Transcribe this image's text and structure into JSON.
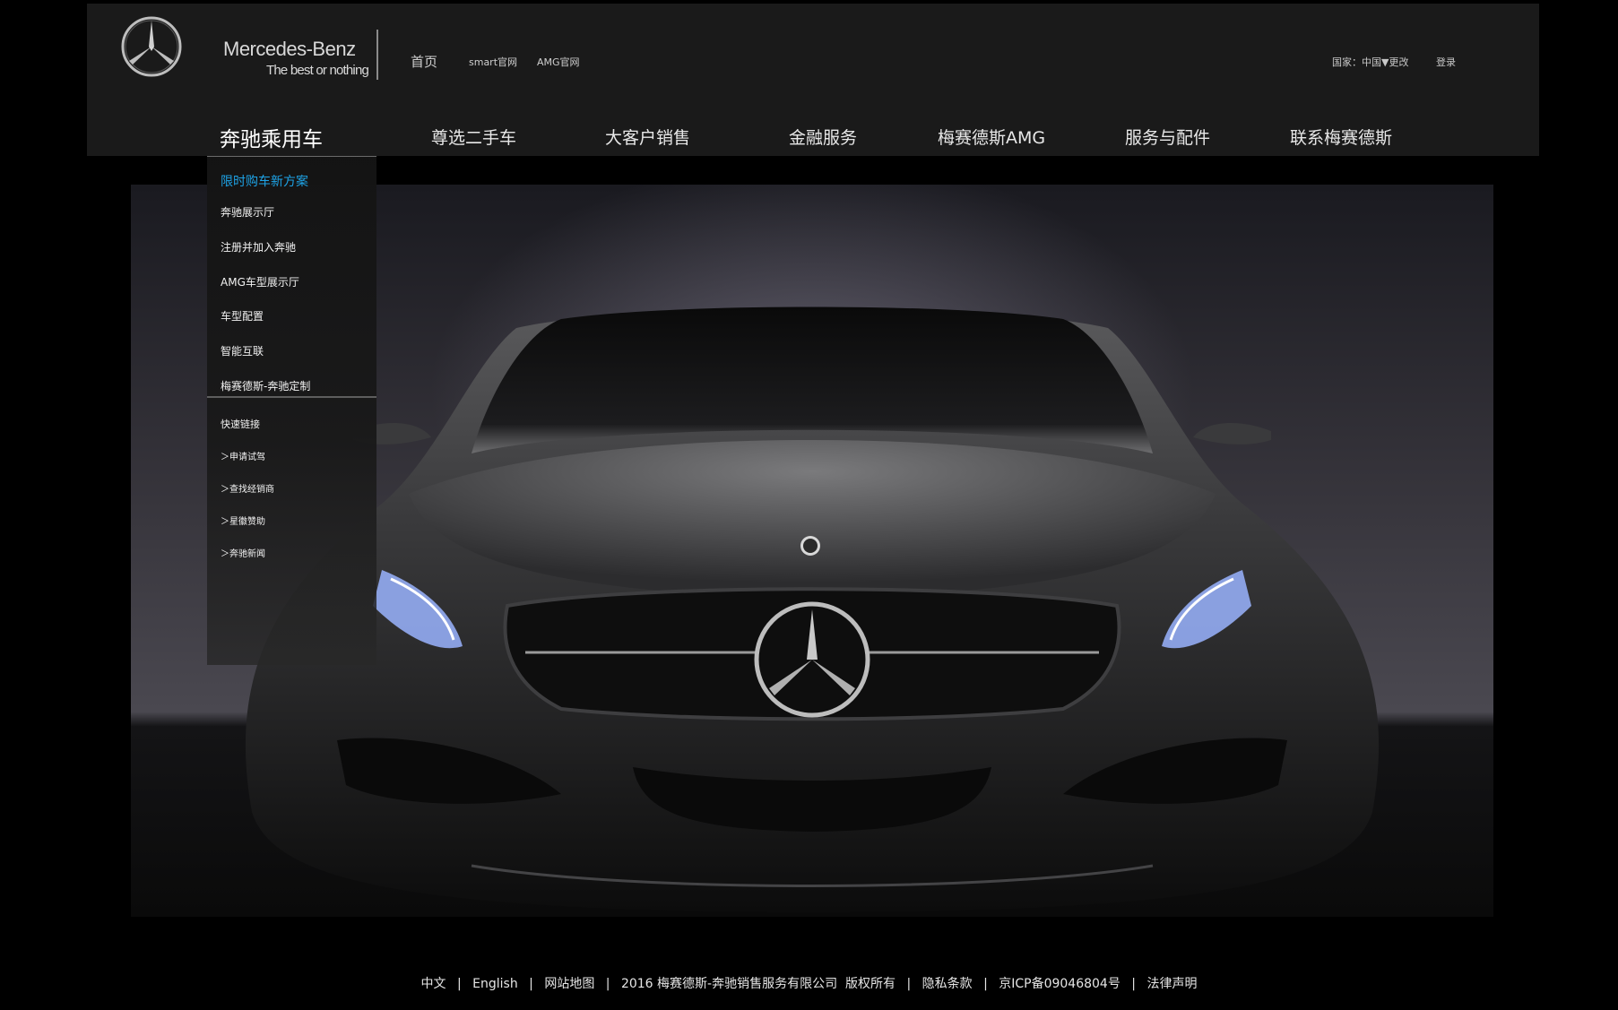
{
  "brand": {
    "name": "Mercedes-Benz",
    "tagline": "The best or nothing",
    "star_color": "#c8c8c8"
  },
  "top_links": {
    "home": "首页",
    "smart": "smart官网",
    "amg": "AMG官网",
    "country": "国家：中国",
    "change": "▼更改",
    "login": "登录"
  },
  "main_nav": [
    "奔驰乘用车",
    "尊选二手车",
    "大客户销售",
    "金融服务",
    "梅赛德斯AMG",
    "服务与配件",
    "联系梅赛德斯"
  ],
  "dropdown": {
    "items": [
      "限时购车新方案",
      "奔驰展示厅",
      "注册并加入奔驰",
      "AMG车型展示厅",
      "车型配置",
      "智能互联",
      "梅赛德斯-奔驰定制"
    ],
    "highlight_color": "#1ea3e6",
    "quick_title": "快速链接",
    "quick_links": [
      "＞申请试驾",
      "＞查找经销商",
      "＞星徽赞助",
      "＞奔驰新闻"
    ]
  },
  "footer": {
    "links": [
      "中文",
      "English",
      "网站地图",
      "2016 梅赛德斯-奔驰销售服务有限公司  版权所有",
      "隐私条款",
      "京ICP备09046804号",
      "法律声明"
    ],
    "separator": "|"
  },
  "colors": {
    "page_bg": "#000000",
    "header_bg": "#1a1a1a",
    "headlight": "#9ab4ff"
  }
}
